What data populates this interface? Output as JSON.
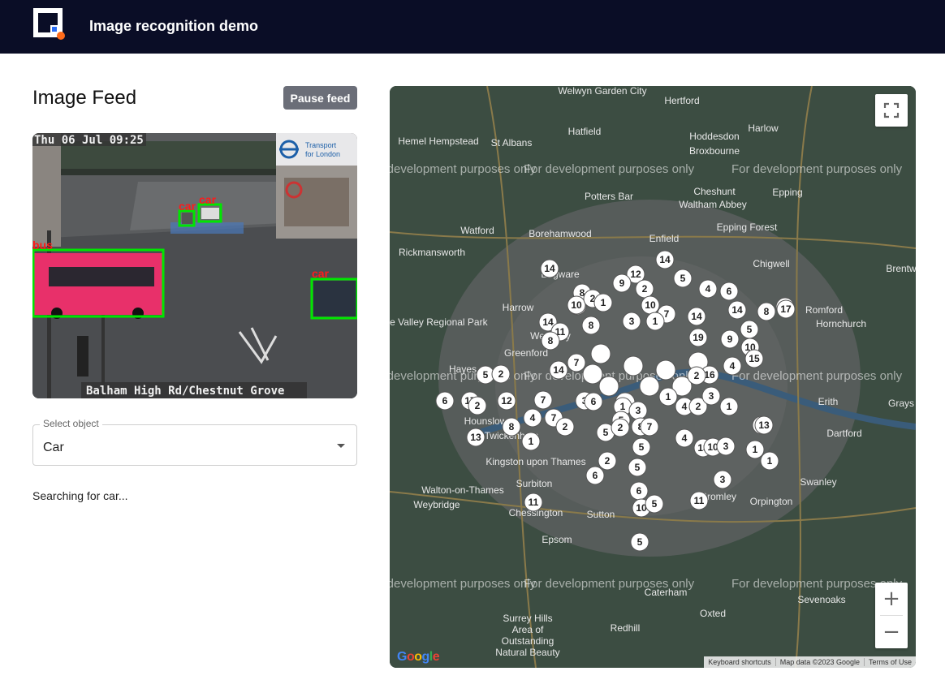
{
  "header": {
    "title": "Image recognition demo",
    "logo_icon": "app-logo-icon"
  },
  "feed": {
    "title": "Image Feed",
    "pause_label": "Pause feed",
    "overlay_timestamp": "Thu 06 Jul 09:25",
    "overlay_location": "Balham High Rd/Chestnut Grove",
    "overlay_brand": "Transport for London",
    "detections": [
      "bus",
      "car",
      "car",
      "car"
    ]
  },
  "select": {
    "label": "Select object",
    "value": "Car",
    "icon": "chevron-down-icon"
  },
  "status": "Searching for car...",
  "map": {
    "watermark": "For development purposes only",
    "places": [
      "Welwyn Garden City",
      "Hertford",
      "Hatfield",
      "Hoddesdon",
      "Harlow",
      "Hemel Hempstead",
      "St Albans",
      "Broxbourne",
      "Potters Bar",
      "Cheshunt",
      "Epping",
      "Waltham Abbey",
      "Watford",
      "Borehamwood",
      "Epping Forest",
      "Enfield",
      "Rickmansworth",
      "Chigwell",
      "Brentwood",
      "Edgware",
      "Harrow",
      "Romford",
      "Colne Valley Regional Park",
      "Hornchurch",
      "Wembley",
      "Greenford",
      "Hayes",
      "Erith",
      "Grays",
      "Hounslow",
      "Twickenham",
      "Dartford",
      "Kingston upon Thames",
      "Surbiton",
      "Walton-on-Thames",
      "Weybridge",
      "Chessington",
      "Sutton",
      "Epsom",
      "Bromley",
      "Orpington",
      "Swanley",
      "Caterham",
      "Oxted",
      "Sevenoaks",
      "Surrey Hills Area of Outstanding Natural Beauty",
      "Redhill"
    ],
    "attribution": [
      "Keyboard shortcuts",
      "Map data ©2023 Google",
      "Terms of Use"
    ],
    "google_logo": "Google",
    "zoom_in": "+",
    "zoom_out": "−",
    "markers": [
      "14",
      "12",
      "9",
      "2",
      "14",
      "5",
      "4",
      "6",
      "8",
      "9",
      "10",
      "2",
      "1",
      "3",
      "10",
      "7",
      "14",
      "14",
      "5",
      "8",
      "14",
      "1",
      "11",
      "8",
      "19",
      "10",
      "9",
      "15",
      "17",
      "8",
      "4",
      "16",
      "14",
      "7",
      "2",
      "5",
      "2",
      "6",
      "17",
      "2",
      "12",
      "7",
      "3",
      "6",
      "1",
      "3",
      "1",
      "4",
      "2",
      "3",
      "1",
      "4",
      "7",
      "2",
      "5",
      "5",
      "8",
      "13",
      "1",
      "2",
      "8",
      "4",
      "13",
      "10",
      "4",
      "3",
      "1",
      "7",
      "5",
      "2",
      "6",
      "5",
      "6",
      "11",
      "10",
      "5",
      "5",
      "11",
      "3",
      "17",
      "13",
      "1"
    ]
  },
  "colors": {
    "header_bg": "#0a0d26",
    "accent": "#ff6b1a",
    "detection_box": "#00e600",
    "detection_label": "#ff1a1a"
  }
}
